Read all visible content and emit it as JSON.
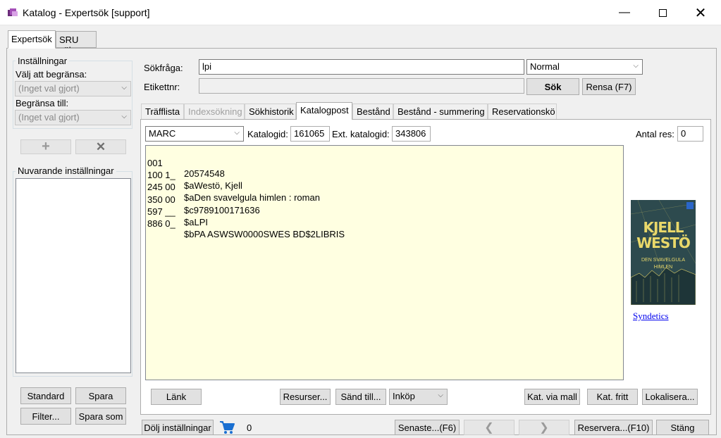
{
  "window": {
    "title": "Katalog - Expertsök [support]"
  },
  "outer_tabs": [
    {
      "label": "Expertsök",
      "active": true
    },
    {
      "label": "SRU sök",
      "active": false
    }
  ],
  "settings": {
    "group_title": "Inställningar",
    "limit_label": "Välj att begränsa:",
    "limit_value": "(Inget val gjort)",
    "limit_to_label": "Begränsa till:",
    "limit_to_value": "(Inget val gjort)",
    "add_icon": "plus-icon",
    "remove_icon": "x-icon",
    "current_title": "Nuvarande inställningar",
    "standard_label": "Standard",
    "save_label": "Spara",
    "filter_label": "Filter...",
    "save_as_label": "Spara som"
  },
  "search": {
    "query_label": "Sökfråga:",
    "query_value": "lpi",
    "mode_value": "Normal",
    "tag_label": "Etikettnr:",
    "tag_value": "",
    "search_label": "Sök",
    "clear_label": "Rensa (F7)"
  },
  "inner_tabs": [
    {
      "label": "Träfflista",
      "state": "normal"
    },
    {
      "label": "Indexsökning",
      "state": "disabled"
    },
    {
      "label": "Sökhistorik",
      "state": "normal"
    },
    {
      "label": "Katalogpost",
      "state": "active"
    },
    {
      "label": "Bestånd",
      "state": "normal"
    },
    {
      "label": "Bestånd - summering",
      "state": "normal"
    },
    {
      "label": "Reservationskö",
      "state": "normal"
    }
  ],
  "record": {
    "format_value": "MARC",
    "catalog_id_label": "Katalogid:",
    "catalog_id_value": "161065",
    "ext_catalog_id_label": "Ext. katalogid:",
    "ext_catalog_id_value": "343806",
    "res_count_label": "Antal res:",
    "res_count_value": "0",
    "marc_lines": [
      {
        "tag": "001",
        "value": "20574548"
      },
      {
        "tag": "100 1_",
        "value": "$aWestö, Kjell"
      },
      {
        "tag": "245 00",
        "value": "$aDen svavelgula himlen : roman"
      },
      {
        "tag": "350 00",
        "value": "$c9789100171636"
      },
      {
        "tag": "597 __",
        "value": "$aLPI"
      },
      {
        "tag": "886 0_",
        "value": "$bPA ASWSW0000SWES BD$2LIBRIS"
      }
    ],
    "cover": {
      "author_line1": "KJELL",
      "author_line2": "WESTÖ",
      "title_line1": "DEN SVAVELGULA",
      "title_line2": "HIMLEN"
    },
    "syndetics_link": "Syndetics",
    "link_label": "Länk",
    "resources_label": "Resurser...",
    "send_to_label": "Sänd till...",
    "purchase_value": "Inköp",
    "cat_template_label": "Kat. via mall",
    "cat_free_label": "Kat. fritt",
    "localize_label": "Lokalisera..."
  },
  "bottom": {
    "hide_settings_label": "Dölj inställningar",
    "cart_icon": "shopping-cart-icon",
    "cart_count": "0",
    "recent_label": "Senaste...(F6)",
    "prev_icon": "chevron-left-icon",
    "next_icon": "chevron-right-icon",
    "reserve_label": "Reservera...(F10)",
    "close_label": "Stäng"
  },
  "colors": {
    "marc_background": "#ffffe1",
    "cover_background": "#2d4a4e",
    "cover_text": "#e9d86a",
    "link": "#0000ee",
    "cart": "#1a6fd1"
  }
}
